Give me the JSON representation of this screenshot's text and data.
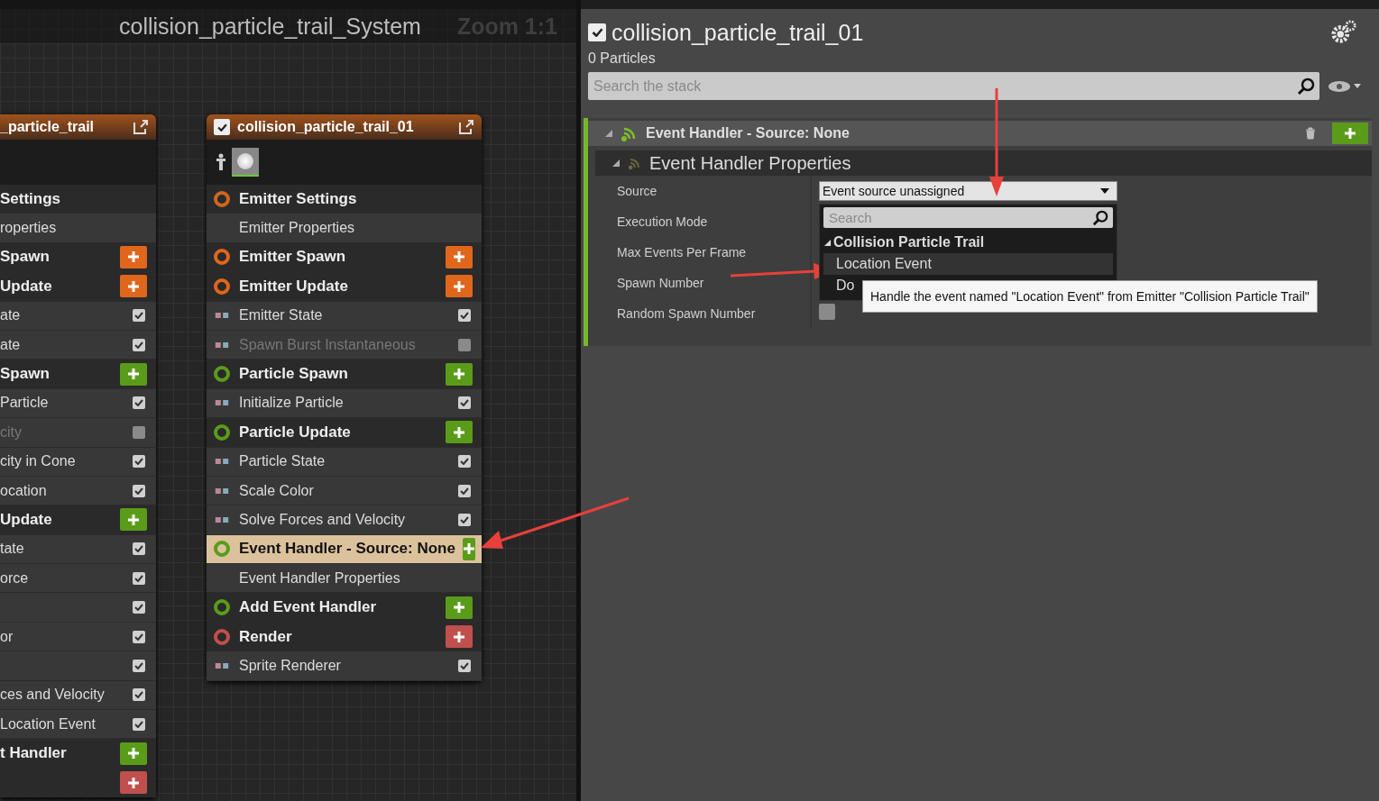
{
  "graph": {
    "title": "collision_particle_trail_System",
    "zoom_label": "Zoom 1:1",
    "nodes": [
      {
        "kind": "partial",
        "title": "_particle_trail",
        "rows": [
          {
            "kind": "section",
            "label": "Settings",
            "selected": false
          },
          {
            "kind": "property",
            "label": "roperties",
            "selected": false
          },
          {
            "kind": "section",
            "label": "Spawn",
            "color": "#e0661c",
            "selected": false
          },
          {
            "kind": "section",
            "label": "Update",
            "color": "#e0661c",
            "selected": false
          },
          {
            "kind": "module",
            "label": "ate",
            "checked": true,
            "selected": false
          },
          {
            "kind": "module",
            "label": "ate",
            "checked": true,
            "selected": false
          },
          {
            "kind": "section",
            "label": "Spawn",
            "color": "#5a9c1a",
            "selected": false
          },
          {
            "kind": "module",
            "label": "Particle",
            "checked": true,
            "selected": false
          },
          {
            "kind": "module",
            "label": "city",
            "checked": false,
            "selected": false
          },
          {
            "kind": "module",
            "label": "city in Cone",
            "checked": true,
            "selected": false
          },
          {
            "kind": "module",
            "label": "ocation",
            "checked": true,
            "selected": false
          },
          {
            "kind": "section",
            "label": "Update",
            "color": "#5a9c1a",
            "selected": false
          },
          {
            "kind": "module",
            "label": "tate",
            "checked": true,
            "selected": false
          },
          {
            "kind": "module",
            "label": "orce",
            "checked": true,
            "selected": false
          },
          {
            "kind": "module",
            "checked": true,
            "selected": false
          },
          {
            "kind": "module",
            "label": "or",
            "checked": true,
            "selected": false
          },
          {
            "kind": "module",
            "checked": true,
            "selected": false
          },
          {
            "kind": "module",
            "label": "ces and Velocity",
            "checked": true,
            "selected": false
          },
          {
            "kind": "module",
            "label": "Location Event",
            "checked": true,
            "selected": false
          },
          {
            "kind": "section",
            "label": "t Handler",
            "color": "#5a9c1a",
            "selected": false
          },
          {
            "kind": "section",
            "color": "#c0504d",
            "selected": false
          }
        ]
      },
      {
        "kind": "full",
        "title": "collision_particle_trail_01",
        "enabled": true,
        "rows": [
          {
            "kind": "section",
            "label": "Emitter Settings",
            "selected": false
          },
          {
            "kind": "property",
            "label": "Emitter Properties",
            "selected": false
          },
          {
            "kind": "section",
            "label": "Emitter Spawn",
            "color": "#e0661c",
            "selected": false
          },
          {
            "kind": "section",
            "label": "Emitter Update",
            "color": "#e0661c",
            "selected": false
          },
          {
            "kind": "module",
            "label": "Emitter State",
            "checked": true,
            "selected": false
          },
          {
            "kind": "module",
            "label": "Spawn Burst Instantaneous",
            "checked": false,
            "selected": false
          },
          {
            "kind": "section",
            "label": "Particle Spawn",
            "color": "#5a9c1a",
            "selected": false
          },
          {
            "kind": "module",
            "label": "Initialize Particle",
            "checked": true,
            "selected": false
          },
          {
            "kind": "section",
            "label": "Particle Update",
            "color": "#5a9c1a",
            "selected": false
          },
          {
            "kind": "module",
            "label": "Particle State",
            "checked": true,
            "selected": false
          },
          {
            "kind": "module",
            "label": "Scale Color",
            "checked": true,
            "selected": false
          },
          {
            "kind": "module",
            "label": "Solve Forces and Velocity",
            "checked": true,
            "selected": false
          },
          {
            "kind": "section",
            "label": "Event Handler - Source: None",
            "color": "#5a9c1a",
            "selected": true
          },
          {
            "kind": "property",
            "label": "Event Handler Properties",
            "selected": false
          },
          {
            "kind": "section",
            "label": "Add Event Handler",
            "color": "#5a9c1a",
            "selected": false
          },
          {
            "kind": "section",
            "label": "Render",
            "color": "#c0504d",
            "selected": false
          },
          {
            "kind": "module",
            "label": "Sprite Renderer",
            "checked": true,
            "selected": false
          }
        ]
      }
    ]
  },
  "details": {
    "title": "collision_particle_trail_01",
    "enabled": true,
    "particle_count": "0 Particles",
    "search": {
      "placeholder": "Search the stack"
    },
    "group": {
      "title": "Event Handler - Source: None",
      "expanded": true,
      "subgroup": {
        "title": "Event Handler Properties",
        "expanded": true,
        "properties": [
          {
            "kind": "dropdown",
            "label": "Source",
            "value": "Event source unassigned"
          },
          {
            "kind": "empty",
            "label": "Execution Mode"
          },
          {
            "kind": "empty",
            "label": "Max Events Per Frame"
          },
          {
            "kind": "empty",
            "label": "Spawn Number"
          },
          {
            "kind": "checkbox",
            "label": "Random Spawn Number",
            "checked": false
          }
        ]
      }
    }
  },
  "dropdown_menu": {
    "search_placeholder": "Search",
    "category": {
      "label": "Collision Particle Trail",
      "expanded": true
    },
    "items": [
      {
        "label": "Location Event",
        "selected": true
      },
      {
        "label": "Do",
        "selected": false
      }
    ],
    "tooltip": "Handle the event named \"Location Event\" from Emitter \"Collision Particle Trail\""
  }
}
